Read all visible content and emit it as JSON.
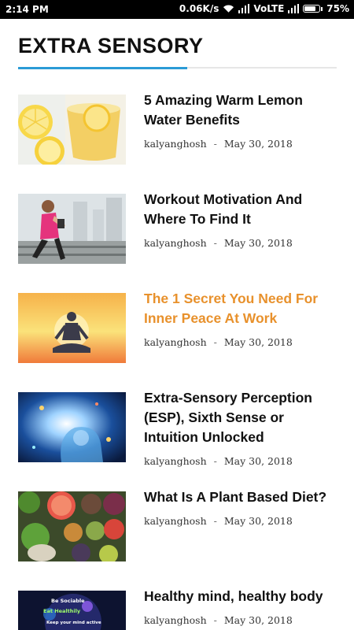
{
  "status": {
    "time": "2:14 PM",
    "speed": "0.06K/s",
    "network": "VoLTE",
    "battery": "75%"
  },
  "section": {
    "title": "EXTRA SENSORY",
    "accent_color": "#2b9bd6"
  },
  "articles": [
    {
      "title": "5 Amazing Warm Lemon Water Benefits",
      "author": "kalyanghosh",
      "sep": "-",
      "date": "May 30, 2018",
      "thumb_icon": "lemon-water-image"
    },
    {
      "title": "Workout Motivation And Where To Find It",
      "author": "kalyanghosh",
      "sep": "-",
      "date": "May 30, 2018",
      "thumb_icon": "runner-image"
    },
    {
      "title": "The 1 Secret You Need For Inner Peace At Work",
      "author": "kalyanghosh",
      "sep": "-",
      "date": "May 30, 2018",
      "thumb_icon": "meditation-image",
      "highlight_color": "#e8912c"
    },
    {
      "title": "Extra-Sensory Perception (ESP), Sixth Sense or Intuition Unlocked",
      "author": "kalyanghosh",
      "sep": "-",
      "date": "May 30, 2018",
      "thumb_icon": "cosmic-head-image"
    },
    {
      "title": "What Is A Plant Based Diet?",
      "author": "kalyanghosh",
      "sep": "-",
      "date": "May 30, 2018",
      "thumb_icon": "vegetables-image"
    },
    {
      "title": "Healthy mind, healthy body",
      "author": "kalyanghosh",
      "sep": "-",
      "date": "May 30, 2018",
      "thumb_icon": "healthy-mind-image",
      "thumb_text": [
        "Be Sociable",
        "Eat Healthily",
        "Keep your mind active"
      ]
    }
  ]
}
